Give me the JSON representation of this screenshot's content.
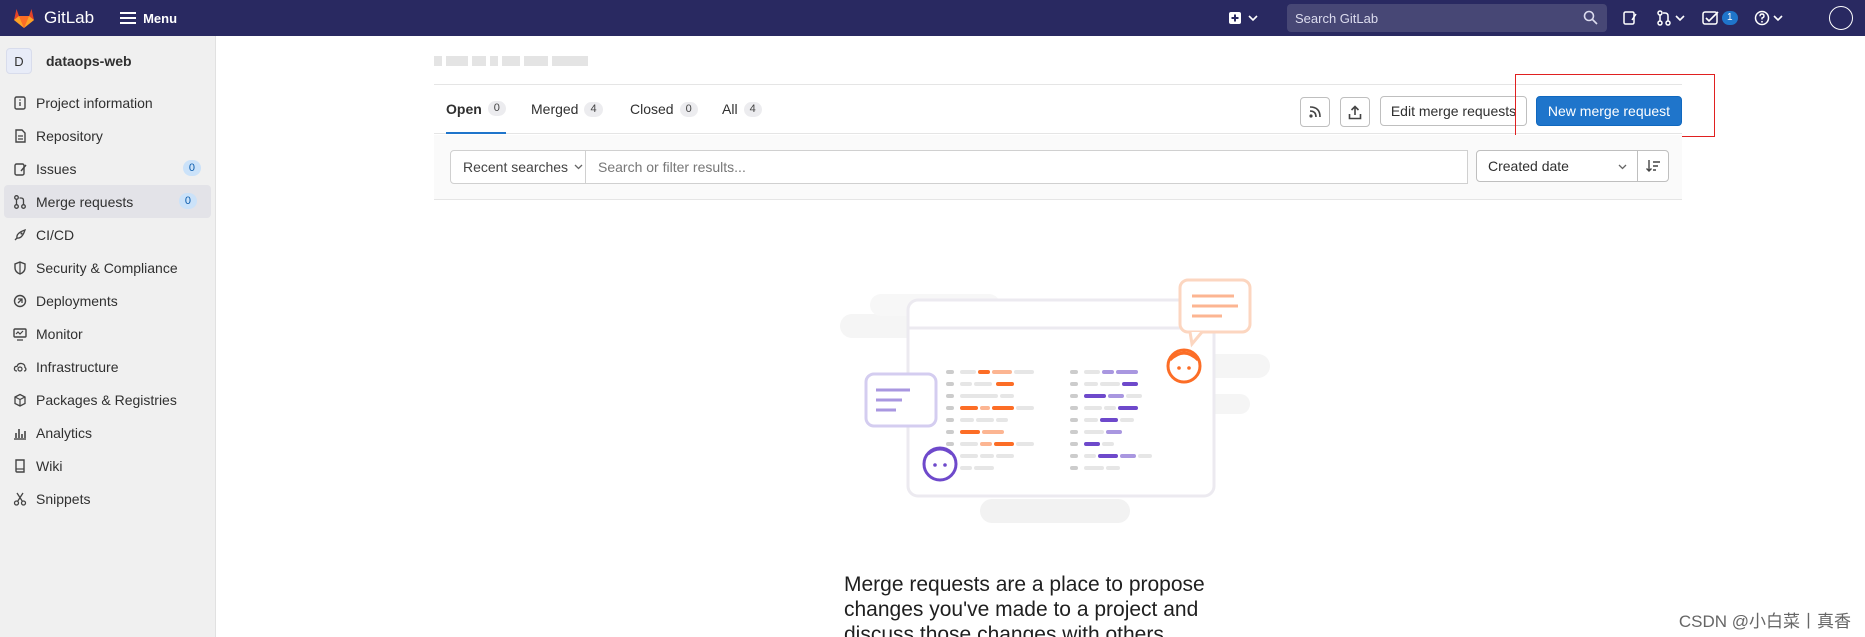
{
  "topbar": {
    "brand": "GitLab",
    "menu_label": "Menu",
    "search_placeholder": "Search GitLab",
    "todo_count": "1",
    "bg_color": "#292961"
  },
  "sidebar": {
    "project_initial": "D",
    "project_name": "dataops-web",
    "items": [
      {
        "label": "Project information",
        "icon": "info-icon"
      },
      {
        "label": "Repository",
        "icon": "doc-icon"
      },
      {
        "label": "Issues",
        "icon": "issues-icon",
        "badge": "0"
      },
      {
        "label": "Merge requests",
        "icon": "merge-icon",
        "badge": "0",
        "active": true
      },
      {
        "label": "CI/CD",
        "icon": "rocket-icon"
      },
      {
        "label": "Security & Compliance",
        "icon": "shield-icon"
      },
      {
        "label": "Deployments",
        "icon": "deploy-icon"
      },
      {
        "label": "Monitor",
        "icon": "monitor-icon"
      },
      {
        "label": "Infrastructure",
        "icon": "cloud-icon"
      },
      {
        "label": "Packages & Registries",
        "icon": "package-icon"
      },
      {
        "label": "Analytics",
        "icon": "chart-icon"
      },
      {
        "label": "Wiki",
        "icon": "book-icon"
      },
      {
        "label": "Snippets",
        "icon": "scissors-icon"
      }
    ]
  },
  "tabs": [
    {
      "label": "Open",
      "count": "0"
    },
    {
      "label": "Merged",
      "count": "4"
    },
    {
      "label": "Closed",
      "count": "0"
    },
    {
      "label": "All",
      "count": "4"
    }
  ],
  "actions": {
    "edit_label": "Edit merge requests",
    "new_label": "New merge request"
  },
  "filter": {
    "recent_label": "Recent searches",
    "input_placeholder": "Search or filter results...",
    "sort_label": "Created date"
  },
  "empty_state": {
    "title": "Merge requests are a place to propose changes you've made to a project and discuss those changes with others"
  },
  "watermark": "CSDN @小白菜丨真香",
  "colors": {
    "accent": "#1f75cb",
    "highlight": "#e02020"
  }
}
